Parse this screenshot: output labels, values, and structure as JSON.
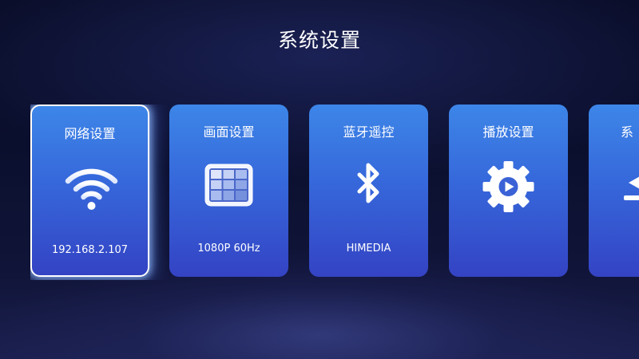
{
  "page": {
    "title": "系统设置"
  },
  "tiles": [
    {
      "title": "网络设置",
      "value": "192.168.2.107",
      "icon": "wifi-icon",
      "focused": true
    },
    {
      "title": "画面设置",
      "value": "1080P 60Hz",
      "icon": "display-grid-icon",
      "focused": false
    },
    {
      "title": "蓝牙遥控",
      "value": "HIMEDIA",
      "icon": "bluetooth-icon",
      "focused": false
    },
    {
      "title": "播放设置",
      "value": "",
      "icon": "playback-gear-icon",
      "focused": false
    },
    {
      "title": "系",
      "value": "",
      "icon": "partial-icon",
      "focused": false
    }
  ],
  "colors": {
    "tile_top": "#3d86e8",
    "tile_bottom": "#3443c4",
    "background": "#0b0f2e",
    "focus_border": "#ffffff"
  }
}
